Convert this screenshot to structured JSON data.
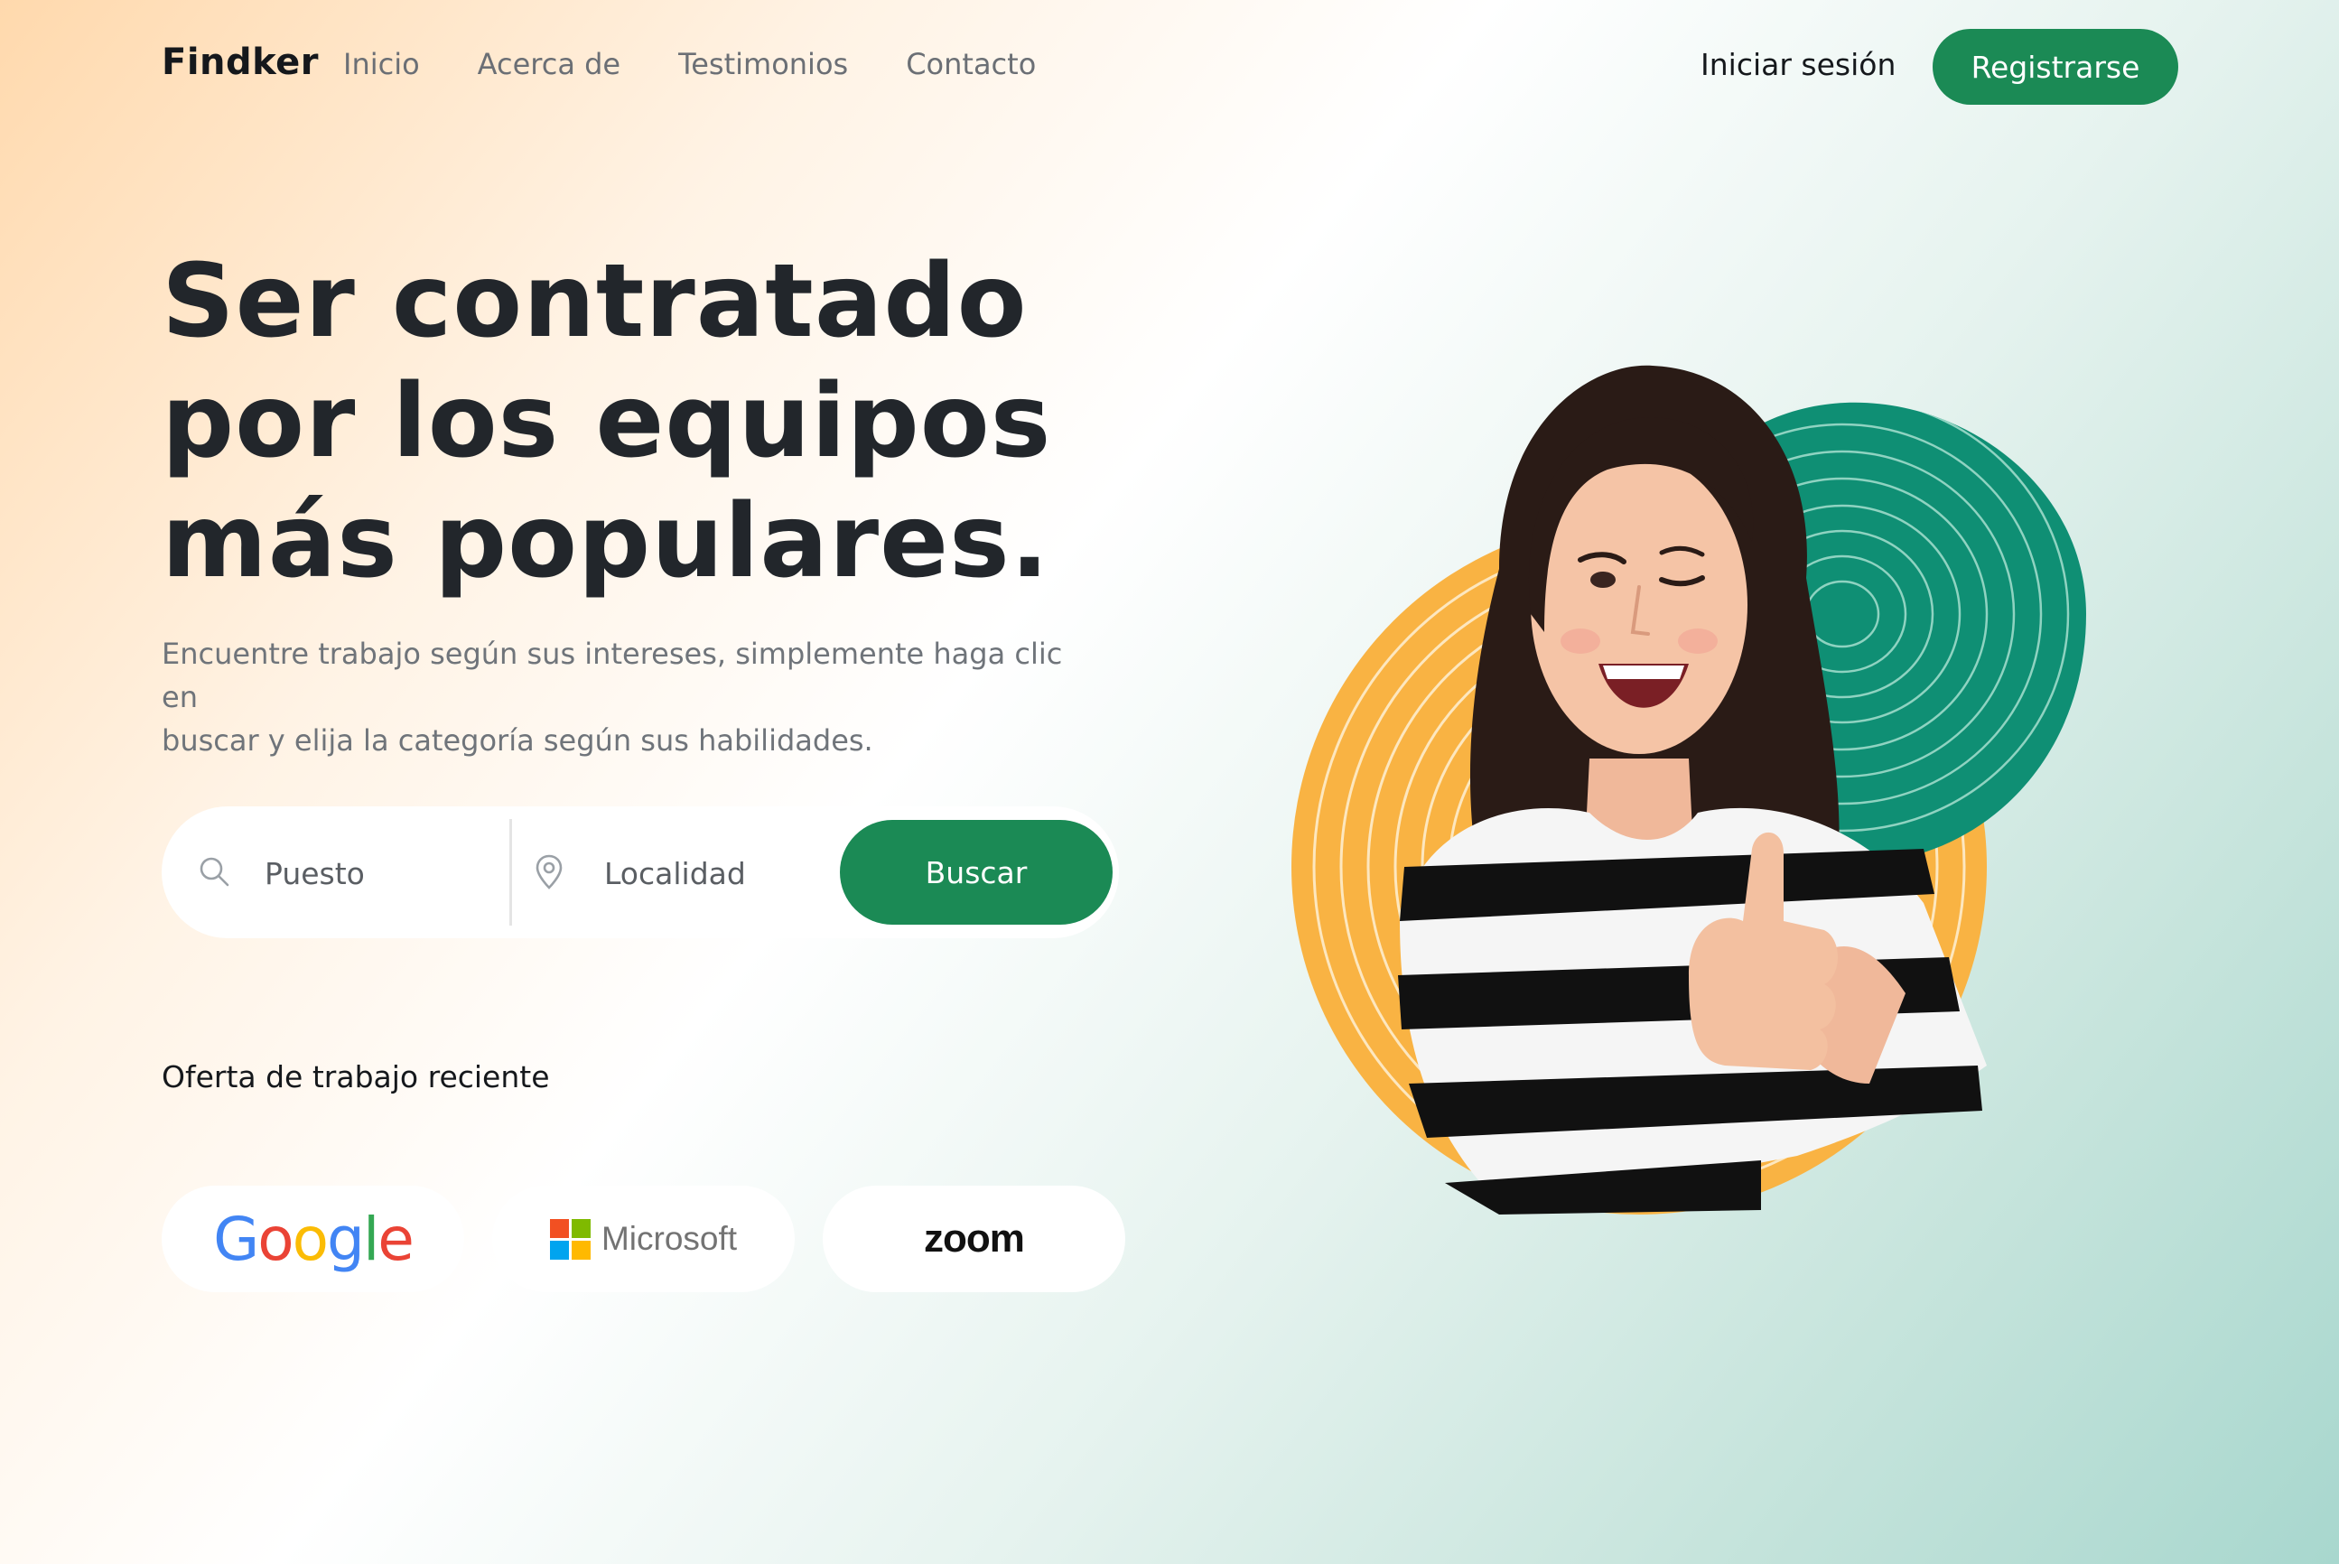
{
  "nav": {
    "brand": "Findker",
    "links": [
      "Inicio",
      "Acerca de",
      "Testimonios",
      "Contacto"
    ],
    "login": "Iniciar sesión",
    "register": "Registrarse"
  },
  "hero": {
    "title_lines": [
      "Ser contratado",
      "por los equipos",
      "más populares."
    ],
    "subtitle_lines": [
      "Encuentre trabajo según sus intereses, simplemente haga clic en",
      "buscar y elija la categoría según sus habilidades."
    ]
  },
  "search": {
    "job_placeholder": "Puesto",
    "location_placeholder": "Localidad",
    "button": "Buscar",
    "icons": [
      "search-icon",
      "location-pin-icon"
    ]
  },
  "recent": {
    "heading": "Oferta de trabajo reciente",
    "companies": [
      "Google",
      "Microsoft",
      "zoom"
    ]
  },
  "colors": {
    "accent": "#1b8a55",
    "teal_blob": "#0f8f74",
    "orange_blob": "#f9b343",
    "google": [
      "#4285F4",
      "#EA4335",
      "#FBBC05",
      "#4285F4",
      "#34A853",
      "#EA4335"
    ],
    "microsoft": [
      "#F25022",
      "#7FBA00",
      "#00A4EF",
      "#FFB900"
    ]
  }
}
